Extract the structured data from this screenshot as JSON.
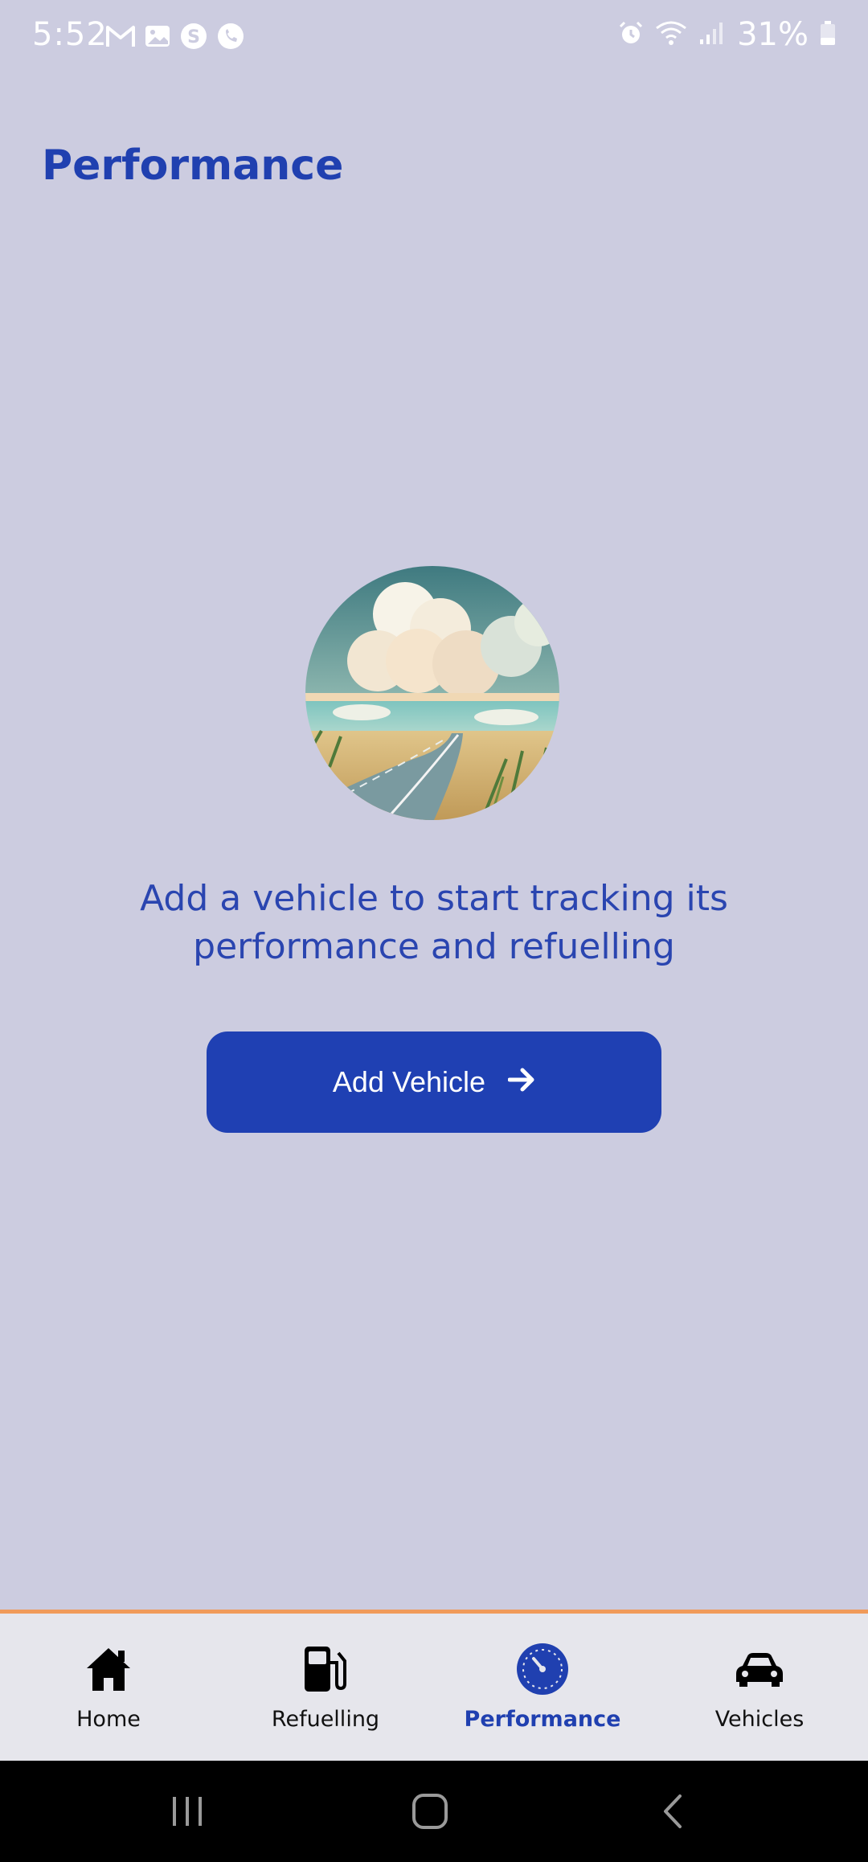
{
  "status_bar": {
    "time": "5:52",
    "battery": "31%",
    "left_icons": [
      "gmail-icon",
      "gallery-icon",
      "skype-icon",
      "viber-icon"
    ],
    "right_icons": [
      "alarm-icon",
      "wifi-icon",
      "signal-icon",
      "battery-icon"
    ]
  },
  "header": {
    "title": "Performance"
  },
  "main": {
    "empty_message": "Add a vehicle to start tracking its performance and refuelling",
    "add_button_label": "Add Vehicle",
    "add_button_icon": "arrow-right-icon"
  },
  "bottom_nav": {
    "items": [
      {
        "label": "Home",
        "icon": "home-icon",
        "active": false
      },
      {
        "label": "Refuelling",
        "icon": "fuel-pump-icon",
        "active": false
      },
      {
        "label": "Performance",
        "icon": "speedometer-icon",
        "active": true
      },
      {
        "label": "Vehicles",
        "icon": "car-icon",
        "active": false
      }
    ]
  },
  "colors": {
    "background": "#cccce0",
    "accent": "#2040b0",
    "nav_border": "#f09a5a",
    "nav_background": "#e6e6ec"
  }
}
